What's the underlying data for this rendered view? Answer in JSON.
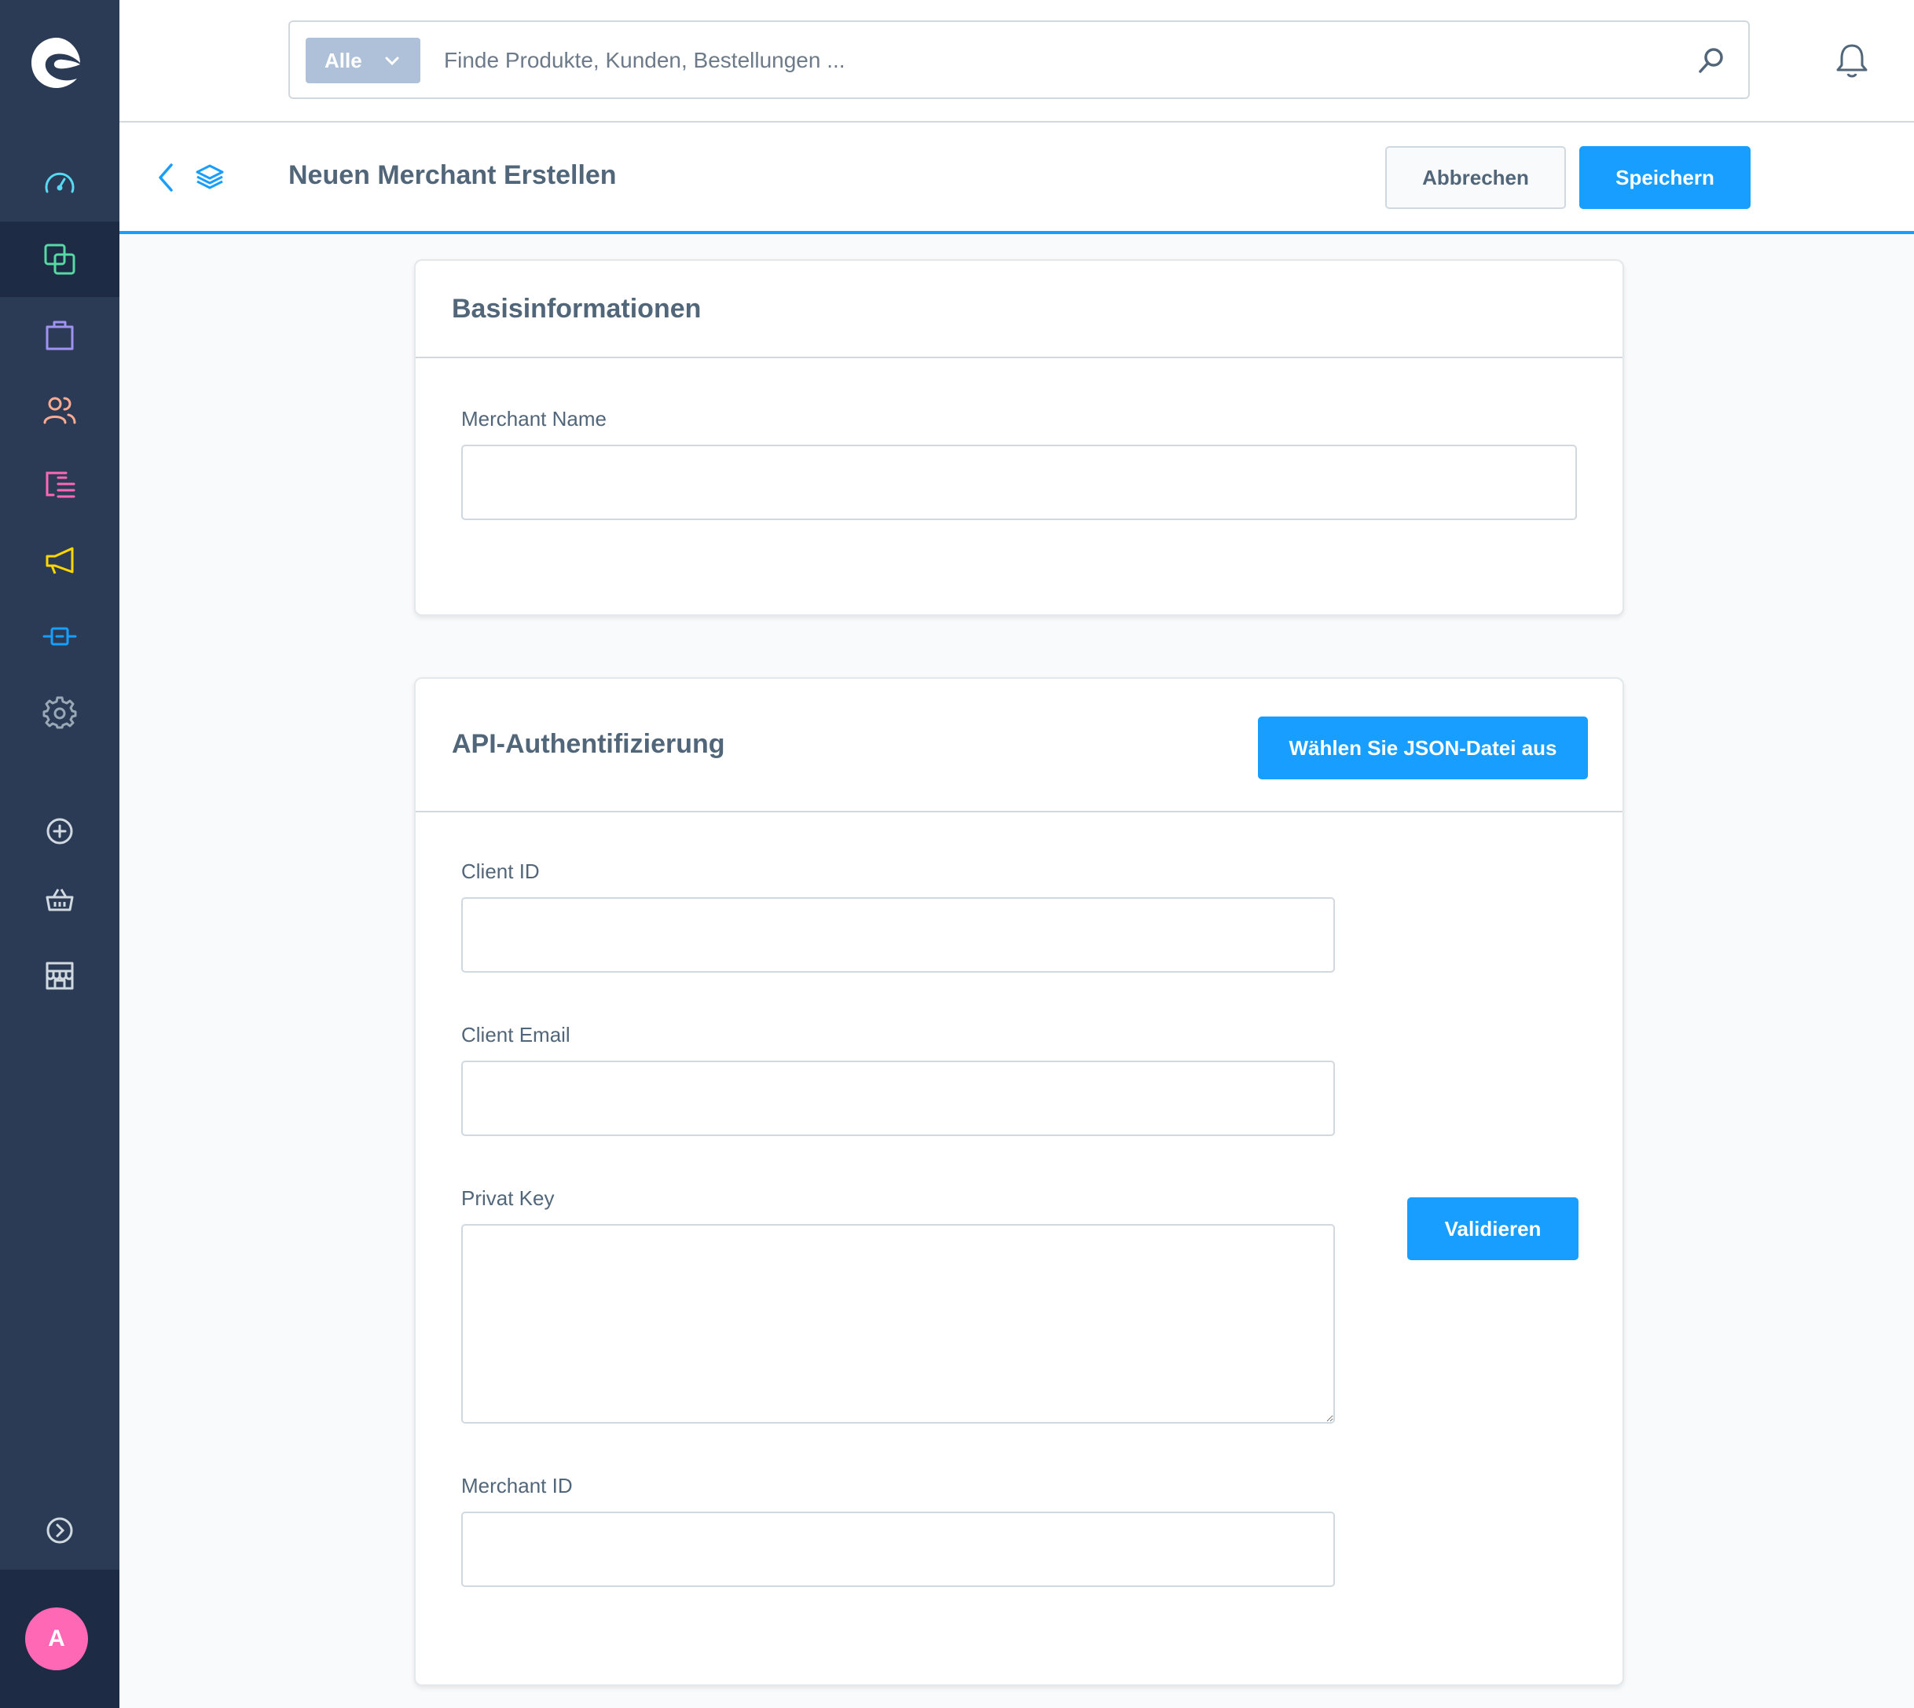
{
  "search": {
    "type_label": "Alle",
    "placeholder": "Finde Produkte, Kunden, Bestellungen ..."
  },
  "smartbar": {
    "title": "Neuen Merchant Erstellen",
    "cancel_label": "Abbrechen",
    "save_label": "Speichern"
  },
  "basic_card": {
    "title": "Basisinformationen",
    "merchant_name_label": "Merchant Name",
    "merchant_name_value": ""
  },
  "api_card": {
    "title": "API-Authentifizierung",
    "json_button_label": "Wählen Sie JSON-Datei aus",
    "client_id_label": "Client ID",
    "client_id_value": "",
    "client_email_label": "Client Email",
    "client_email_value": "",
    "private_key_label": "Privat Key",
    "private_key_value": "",
    "validate_label": "Validieren",
    "merchant_id_label": "Merchant ID",
    "merchant_id_value": ""
  },
  "sidebar": {
    "items": [
      {
        "name": "dashboard-icon",
        "color": "#57d9f3"
      },
      {
        "name": "catalog-icon",
        "color": "#57d9a3",
        "active": true
      },
      {
        "name": "orders-icon",
        "color": "#a092f0"
      },
      {
        "name": "customers-icon",
        "color": "#ffab91"
      },
      {
        "name": "content-icon",
        "color": "#ff68b4"
      },
      {
        "name": "marketing-icon",
        "color": "#ffd700"
      },
      {
        "name": "extensions-icon",
        "color": "#189eff"
      },
      {
        "name": "settings-icon",
        "color": "#9aa8b5"
      },
      {
        "name": "add-sales-channel-icon",
        "color": "#d1d9e0"
      },
      {
        "name": "storefront-basket-icon",
        "color": "#d1d9e0"
      },
      {
        "name": "storefront-shop-icon",
        "color": "#d1d9e0"
      },
      {
        "name": "expand-menu-icon",
        "color": "#d1d9e0"
      }
    ],
    "avatar_initial": "A",
    "avatar_color": "#ff68b4"
  },
  "colors": {
    "primary": "#189eff",
    "sidebar_bg": "#2b3a55",
    "text": "#52667a"
  }
}
